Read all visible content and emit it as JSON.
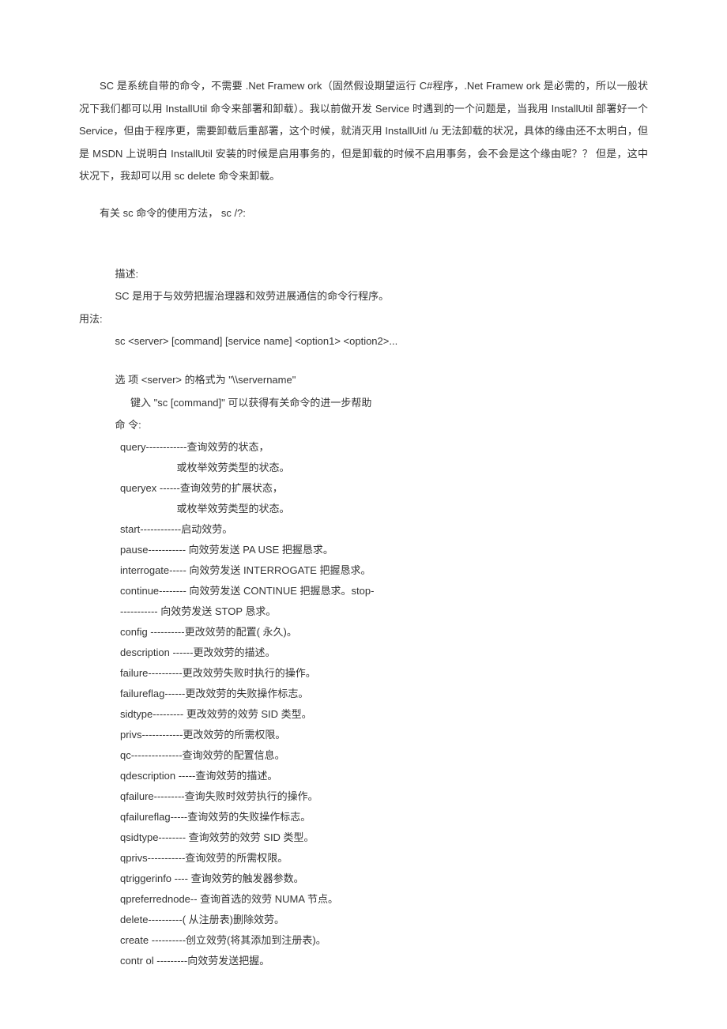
{
  "para1": "SC 是系统自带的命令，不需要 .Net Framew ork（固然假设期望运行 C#程序，.Net Framew ork 是必需的，所以一般状况下我们都可以用 InstallUtil 命令来部署和卸载）。我以前做开发 Service 时遇到的一个问题是，当我用 InstallUtil 部署好一个 Service，但由于程序更，需要卸载后重部署，这个时候，就消灭用 InstallUitl /u 无法卸载的状况，具体的缘由还不太明白，但是 MSDN 上说明白 InstallUtil 安装的时候是启用事务的，但是卸载的时候不启用事务，会不会是这个缘由呢？？ 但是，这中状况下，我却可以用 sc delete 命令来卸载。",
  "para2": "有关 sc 命令的使用方法， sc /?:",
  "desc_label": "描述:",
  "desc_text": "SC 是用于与效劳把握治理器和效劳进展通信的命令行程序。",
  "usage_label": "用法:",
  "usage_text": "sc <server> [command] [service name] <option1> <option2>...",
  "option_text": "选 项  <server>  的格式为 \"\\\\servername\"",
  "help_text": "键入  \"sc [command]\"  可以获得有关命令的进一步帮助",
  "cmd_label": "命 令:",
  "commands": [
    {
      "cmd": "query------------查询效劳的状态，",
      "sub": "或枚举效劳类型的状态。"
    },
    {
      "cmd": "queryex   ------查询效劳的扩展状态，",
      "sub": "或枚举效劳类型的状态。"
    },
    {
      "cmd": "start------------启动效劳。"
    },
    {
      "cmd": "pause----------- 向效劳发送 PA USE 把握恳求。"
    },
    {
      "cmd": "interrogate----- 向效劳发送  INTERROGATE 把握恳求。"
    },
    {
      "cmd": "continue-------- 向效劳发送 CONTINUE 把握恳求。stop-"
    },
    {
      "cmd": "----------- 向效劳发送 STOP 恳求。"
    },
    {
      "cmd": "config ----------更改效劳的配置( 永久)。"
    },
    {
      "cmd": "description ------更改效劳的描述。"
    },
    {
      "cmd": "failure----------更改效劳失败时执行的操作。"
    },
    {
      "cmd": "failureflag------更改效劳的失败操作标志。"
    },
    {
      "cmd": "sidtype--------- 更改效劳的效劳  SID 类型。"
    },
    {
      "cmd": "privs------------更改效劳的所需权限。"
    },
    {
      "cmd": "qc---------------查询效劳的配置信息。"
    },
    {
      "cmd": "qdescription -----查询效劳的描述。"
    },
    {
      "cmd": "qfailure---------查询失败时效劳执行的操作。"
    },
    {
      "cmd": "qfailureflag-----查询效劳的失败操作标志。"
    },
    {
      "cmd": "qsidtype-------- 查询效劳的效劳  SID 类型。"
    },
    {
      "cmd": "qprivs-----------查询效劳的所需权限。"
    },
    {
      "cmd": "qtriggerinfo ---- 查询效劳的触发器参数。"
    },
    {
      "cmd": "qpreferrednode-- 查询首选的效劳  NUMA 节点。"
    },
    {
      "cmd": "delete----------( 从注册表)删除效劳。"
    },
    {
      "cmd": "create ----------创立效劳(将其添加到注册表)。"
    },
    {
      "cmd": "contr ol ---------向效劳发送把握。"
    }
  ]
}
